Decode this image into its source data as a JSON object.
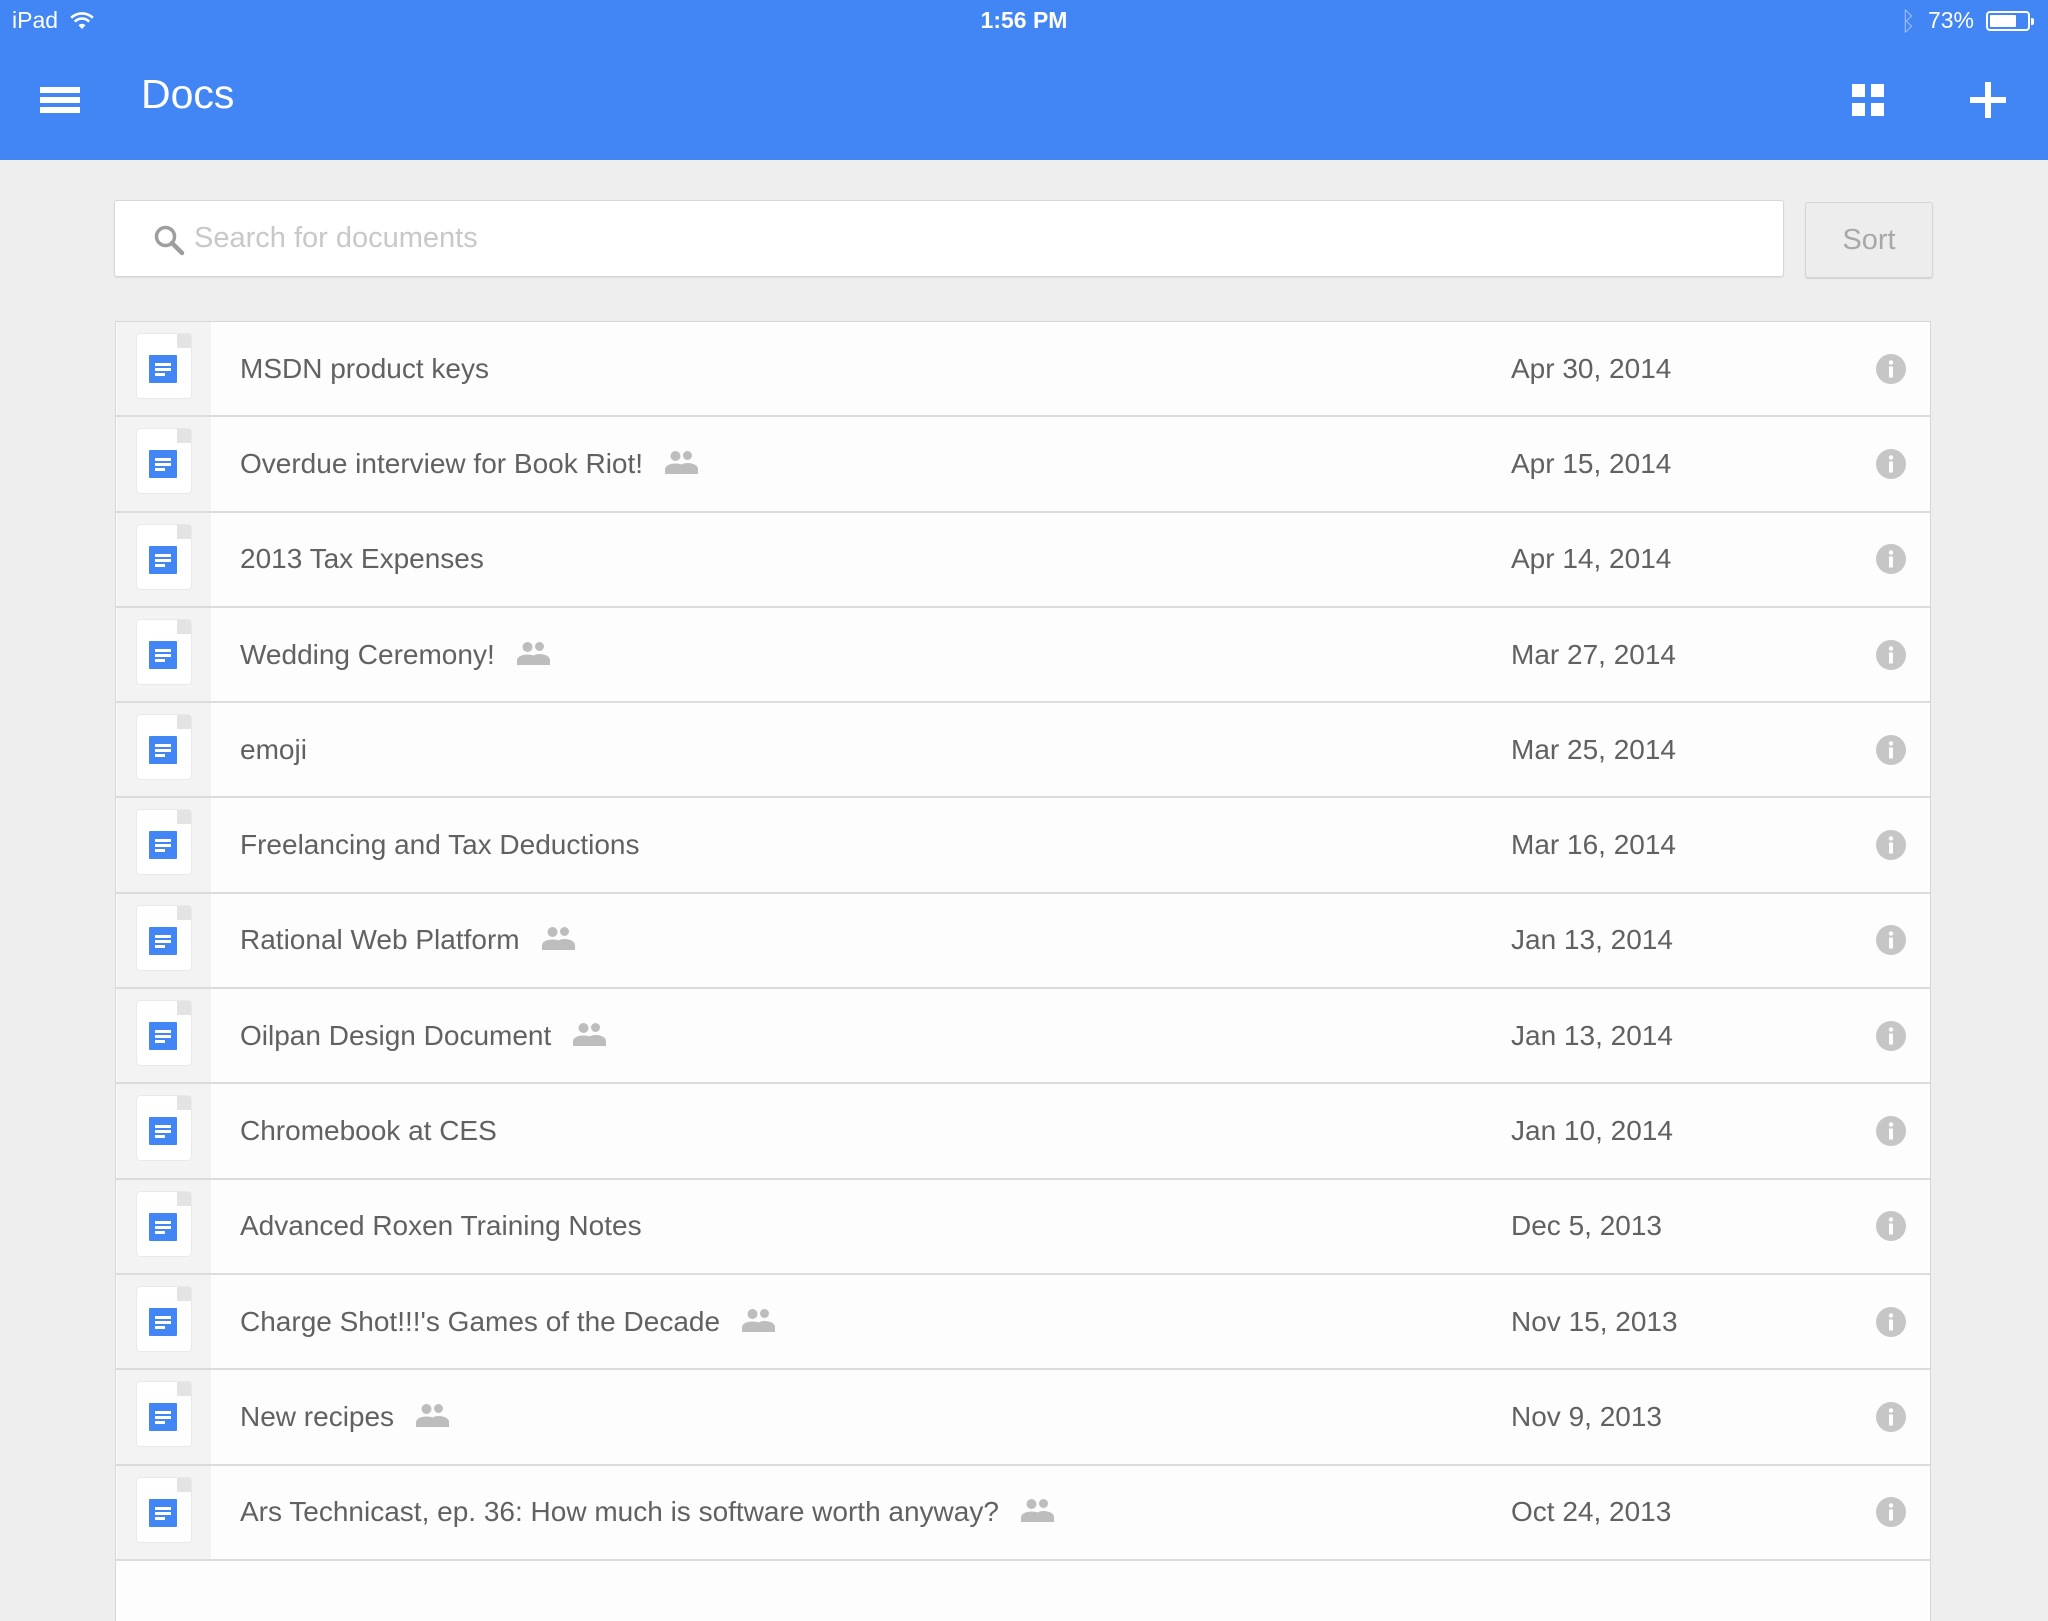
{
  "status_bar": {
    "device": "iPad",
    "time": "1:56 PM",
    "battery_text": "73%",
    "battery_level": 0.73
  },
  "appbar": {
    "title": "Docs",
    "menu_icon": "hamburger-menu-icon",
    "grid_icon": "grid-view-icon",
    "add_icon": "plus-icon"
  },
  "search": {
    "placeholder": "Search for documents",
    "value": ""
  },
  "sort_label": "Sort",
  "colors": {
    "brand": "#4285f4",
    "background": "#eeeeee",
    "text": "#616161",
    "icon_gray": "#c4c4c4"
  },
  "documents": [
    {
      "title": "MSDN product keys",
      "shared": false,
      "date": "Apr 30, 2014"
    },
    {
      "title": "Overdue interview for Book Riot!",
      "shared": true,
      "date": "Apr 15, 2014"
    },
    {
      "title": "2013 Tax Expenses",
      "shared": false,
      "date": "Apr 14, 2014"
    },
    {
      "title": "Wedding Ceremony!",
      "shared": true,
      "date": "Mar 27, 2014"
    },
    {
      "title": "emoji",
      "shared": false,
      "date": "Mar 25, 2014"
    },
    {
      "title": "Freelancing and Tax Deductions",
      "shared": false,
      "date": "Mar 16, 2014"
    },
    {
      "title": "Rational Web Platform",
      "shared": true,
      "date": "Jan 13, 2014"
    },
    {
      "title": "Oilpan Design Document",
      "shared": true,
      "date": "Jan 13, 2014"
    },
    {
      "title": "Chromebook at CES",
      "shared": false,
      "date": "Jan 10, 2014"
    },
    {
      "title": "Advanced Roxen Training Notes",
      "shared": false,
      "date": "Dec 5, 2013"
    },
    {
      "title": "Charge Shot!!!'s Games of the Decade",
      "shared": true,
      "date": "Nov 15, 2013"
    },
    {
      "title": "New recipes",
      "shared": true,
      "date": "Nov 9, 2013"
    },
    {
      "title": "Ars Technicast, ep. 36:  How much is software worth anyway?",
      "shared": true,
      "date": "Oct 24, 2013"
    }
  ]
}
